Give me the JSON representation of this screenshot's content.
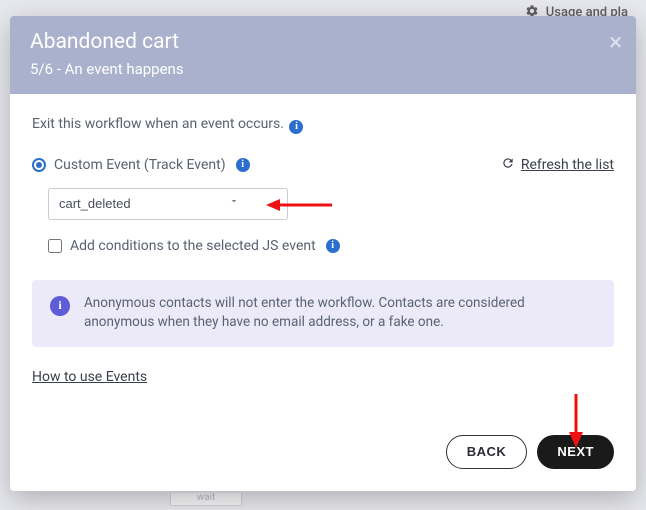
{
  "backdrop": {
    "usage_text": "Usage and pla"
  },
  "header": {
    "title": "Abandoned cart",
    "step": "5/6 - An event happens"
  },
  "body": {
    "intro": "Exit this workflow when an event occurs.",
    "radio_label": "Custom Event (Track Event)",
    "refresh_label": "Refresh the list",
    "select_value": "cart_deleted",
    "checkbox_label": "Add conditions to the selected JS event",
    "note": "Anonymous contacts will not enter the workflow. Contacts are considered anonymous when they have no email address, or a fake one.",
    "howto": "How to use Events"
  },
  "footer": {
    "back": "BACK",
    "next": "NEXT"
  },
  "bg_frag": "wait"
}
